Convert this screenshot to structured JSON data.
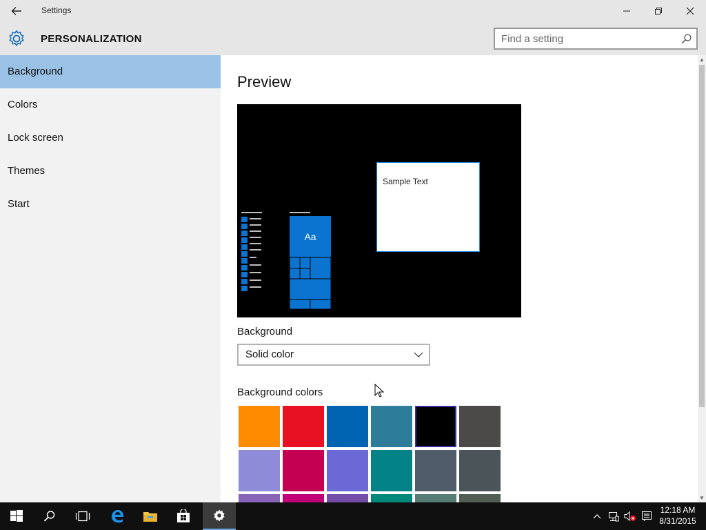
{
  "window": {
    "title": "Settings",
    "controls": {
      "minimize": "minimize-icon",
      "restore": "restore-icon",
      "close": "close-icon"
    }
  },
  "header": {
    "section": "PERSONALIZATION",
    "icon": "gear-icon",
    "search_placeholder": "Find a setting"
  },
  "sidebar": {
    "items": [
      {
        "label": "Background",
        "active": true
      },
      {
        "label": "Colors",
        "active": false
      },
      {
        "label": "Lock screen",
        "active": false
      },
      {
        "label": "Themes",
        "active": false
      },
      {
        "label": "Start",
        "active": false
      }
    ]
  },
  "main": {
    "preview_title": "Preview",
    "preview_tile_text": "Aa",
    "preview_sample_text": "Sample Text",
    "background_label": "Background",
    "background_value": "Solid color",
    "colors_label": "Background colors",
    "swatches": [
      [
        "#ff8c00",
        "#e81123",
        "#0063b1",
        "#2d7d9a",
        "#000000",
        "#4c4a48"
      ],
      [
        "#8e8cd8",
        "#c30052",
        "#6b69d6",
        "#038387",
        "#515c6b",
        "#4a5459"
      ],
      [
        "#8764b8",
        "#bf0077",
        "#744da9",
        "#00897b",
        "#567c73",
        "#525e54"
      ]
    ],
    "selected_swatch": [
      0,
      4
    ]
  },
  "taskbar": {
    "items": [
      "start-icon",
      "search-icon",
      "task-view-icon",
      "edge-icon",
      "file-explorer-icon",
      "store-icon",
      "settings-icon"
    ],
    "active_item": "settings-icon",
    "time": "12:18 AM",
    "date": "8/31/2015"
  },
  "colors": {
    "accent": "#0078d7",
    "sidebar_active": "#99c2e6"
  }
}
